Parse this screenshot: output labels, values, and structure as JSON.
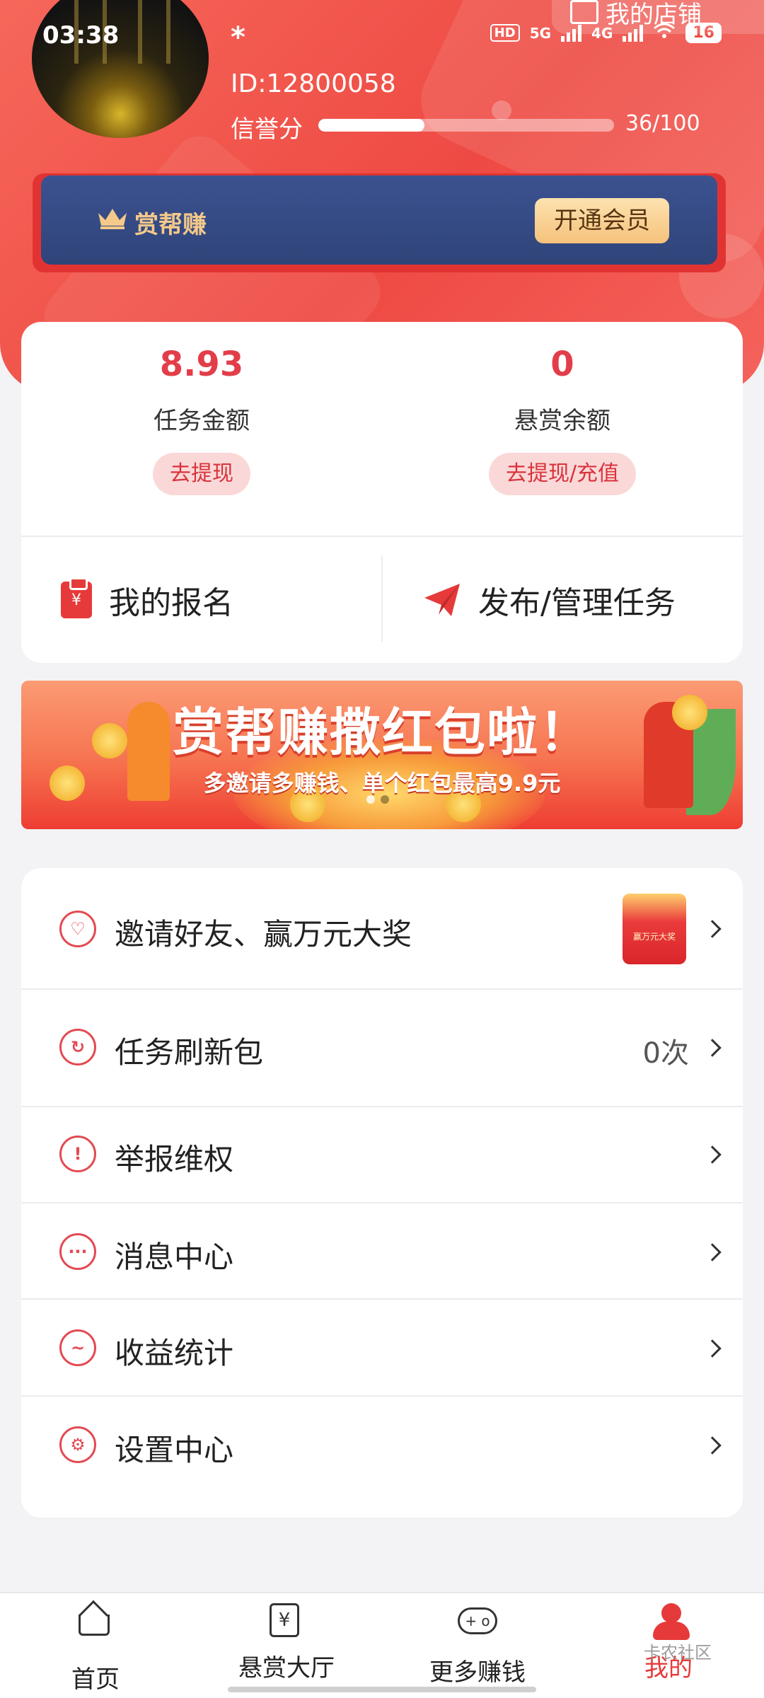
{
  "status_bar": {
    "time": "03:38",
    "hd": "HD",
    "network_1": "5G",
    "network_2": "4G",
    "battery": "16"
  },
  "header": {
    "store_label": "我的店铺",
    "username": "*",
    "user_id": "ID:12800058",
    "credit_label": "信誉分",
    "credit_value": "36/100",
    "credit_fraction": 0.36
  },
  "vip": {
    "brand": "赏帮赚",
    "open_button": "开通会员"
  },
  "wallet": {
    "task_amount_value": "8.93",
    "task_amount_label": "任务金额",
    "task_amount_button": "去提现",
    "reward_balance_value": "0",
    "reward_balance_label": "悬赏余额",
    "reward_balance_button": "去提现/充值",
    "my_signup": "我的报名",
    "publish_manage": "发布/管理任务"
  },
  "banner": {
    "title": "赏帮赚撒红包啦！",
    "subtitle": "多邀请多赚钱、单个红包最高9.9元"
  },
  "menu": {
    "items": [
      {
        "label": "邀请好友、赢万元大奖",
        "value": "",
        "icon": "heart-icon"
      },
      {
        "label": "任务刷新包",
        "value": "0次",
        "icon": "refresh-icon"
      },
      {
        "label": "举报维权",
        "value": "",
        "icon": "warning-icon"
      },
      {
        "label": "消息中心",
        "value": "",
        "icon": "message-icon"
      },
      {
        "label": "收益统计",
        "value": "",
        "icon": "trend-icon"
      },
      {
        "label": "设置中心",
        "value": "",
        "icon": "gear-icon"
      }
    ],
    "promo_thumb_text": "赢万元大奖"
  },
  "bottom_nav": {
    "items": [
      {
        "label": "首页",
        "icon": "home-icon"
      },
      {
        "label": "悬赏大厅",
        "icon": "reward-hall-icon"
      },
      {
        "label": "更多赚钱",
        "icon": "gamepad-icon"
      },
      {
        "label": "我的",
        "icon": "person-icon"
      }
    ],
    "active": "我的"
  },
  "watermark": "卡农社区",
  "colors": {
    "accent": "#e63a3a",
    "header_red": "#ee4a43",
    "vip_blue": "#34497f",
    "vip_gold": "#f6c27c"
  }
}
